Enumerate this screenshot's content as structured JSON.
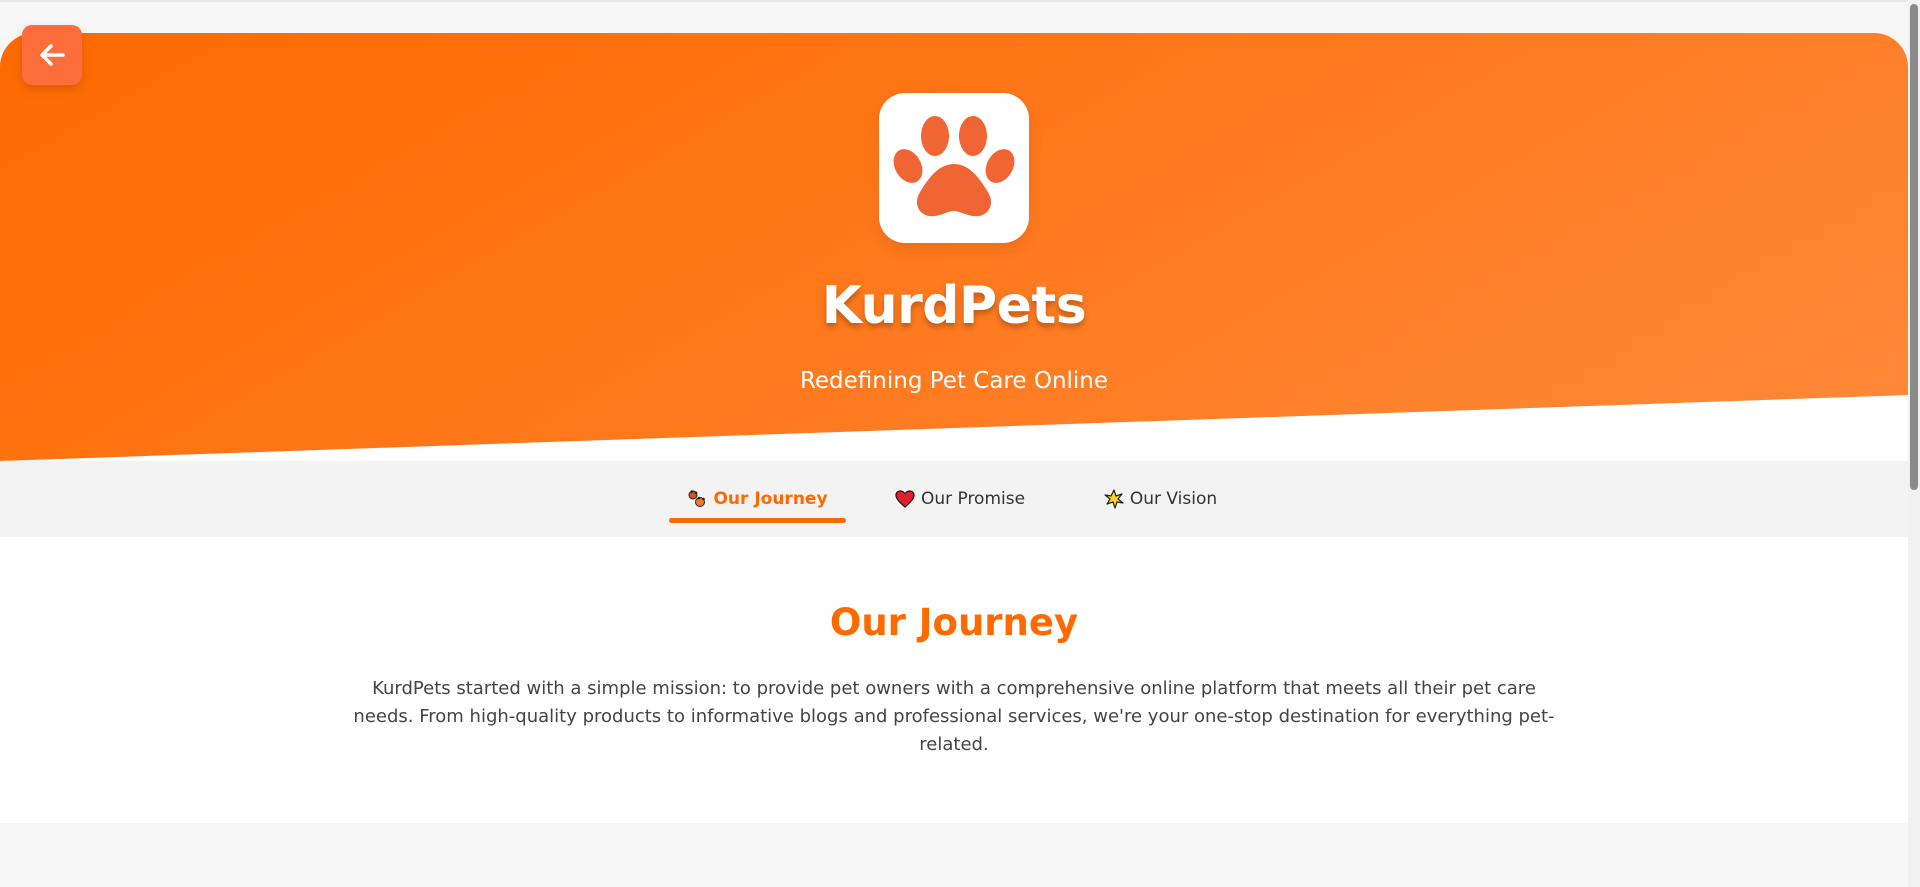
{
  "header": {
    "brand_name": "KurdPets",
    "tagline": "Redefining Pet Care Online",
    "logo_icon": "paw-icon",
    "back_icon": "arrow-left-icon"
  },
  "tabs": [
    {
      "label": "Our Journey",
      "icon": "paws-icon",
      "active": true
    },
    {
      "label": "Our Promise",
      "icon": "heart-icon",
      "active": false
    },
    {
      "label": "Our Vision",
      "icon": "sparkle-icon",
      "active": false
    }
  ],
  "content": {
    "title": "Our Journey",
    "body": "KurdPets started with a simple mission: to provide pet owners with a comprehensive online platform that meets all their pet care needs. From high-quality products to informative blogs and professional services, we're your one-stop destination for everything pet-related."
  },
  "colors": {
    "accent": "#ff6a00",
    "back_button": "#ff6d3a",
    "paw": "#f06533"
  }
}
